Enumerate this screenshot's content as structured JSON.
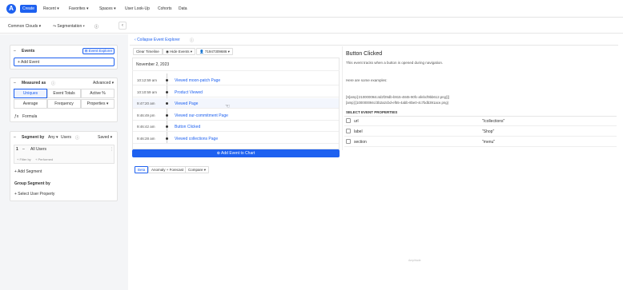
{
  "nav": {
    "logo": "A",
    "create": "Create",
    "items": [
      "Recent ▾",
      "Favorites ▾",
      "Spaces ▾",
      "User Look-Up",
      "Cohorts",
      "Data"
    ]
  },
  "subbar": {
    "project": "Common Clouds ▾",
    "chart_type": "Segmentation ▾",
    "info": "ⓘ",
    "collapse": "‹"
  },
  "events_card": {
    "title": "Events",
    "explorer_btn": "Event Explorer",
    "add_event": "+ Add Event"
  },
  "measured_card": {
    "title": "Measured as",
    "advanced": "Advanced ▾",
    "row1": [
      "Uniques",
      "Event Totals",
      "Active %"
    ],
    "row2": [
      "Average",
      "Frequency",
      "Properties ▾"
    ],
    "formula": "Formula"
  },
  "segment_card": {
    "title": "Segment by",
    "any": "Any ▾",
    "users": "Users",
    "saved": "Saved ▾",
    "index": "1",
    "all_users": "All Users",
    "filter_by": "+ Filter by",
    "performed": "+ Performed",
    "add_segment": "+ Add Segment",
    "group_segment": "Group Segment by",
    "select_prop": "+ Select User Property"
  },
  "explorer": {
    "collapse_label": "Collapse Event Explorer",
    "clear_timeline": "Clear Timeline",
    "hide_events": "Hide Events ▾",
    "user_id": "71947309686 ▾",
    "date": "November 2, 2023",
    "rows": [
      {
        "time": "10:12:59 am",
        "event": "Viewed moon-patch Page"
      },
      {
        "time": "10:10:59 am",
        "event": "Product Viewed"
      },
      {
        "time": "9:47:20 am",
        "event": "Viewed Page"
      },
      {
        "time": "9:46:49 pm",
        "event": "Viewed our-commitment Page"
      },
      {
        "time": "9:46:42 am",
        "event": "Button Clicked"
      },
      {
        "time": "9:46:28 am",
        "event": "Viewed collections Page"
      }
    ],
    "add_to_chart": "Add Event to Chart",
    "bottom_buttons": [
      "Beta",
      "Anomaly + Forecast",
      "Compare ▾"
    ]
  },
  "detail": {
    "title": "Button Clicked",
    "description": "This event tracks when a button is opened during navigation.",
    "examples_label": "Here are some examples:",
    "example_lines": [
      "[S[amp]:210000094c4d2f29db-b915-4845-90fc-afebcf9bb612.png)]]",
      "[amp]:[100000094c/3b2a2cbd-ef55-4abb-8be0-4c7bdb391ace.png)"
    ],
    "props_header": "SELECT EVENT PROPERTIES",
    "props": [
      {
        "name": "url",
        "value": "\"/collections\""
      },
      {
        "name": "label",
        "value": "\"Shop\""
      },
      {
        "name": "section",
        "value": "\"menu\""
      }
    ]
  },
  "footer_tag": "Amplitude"
}
